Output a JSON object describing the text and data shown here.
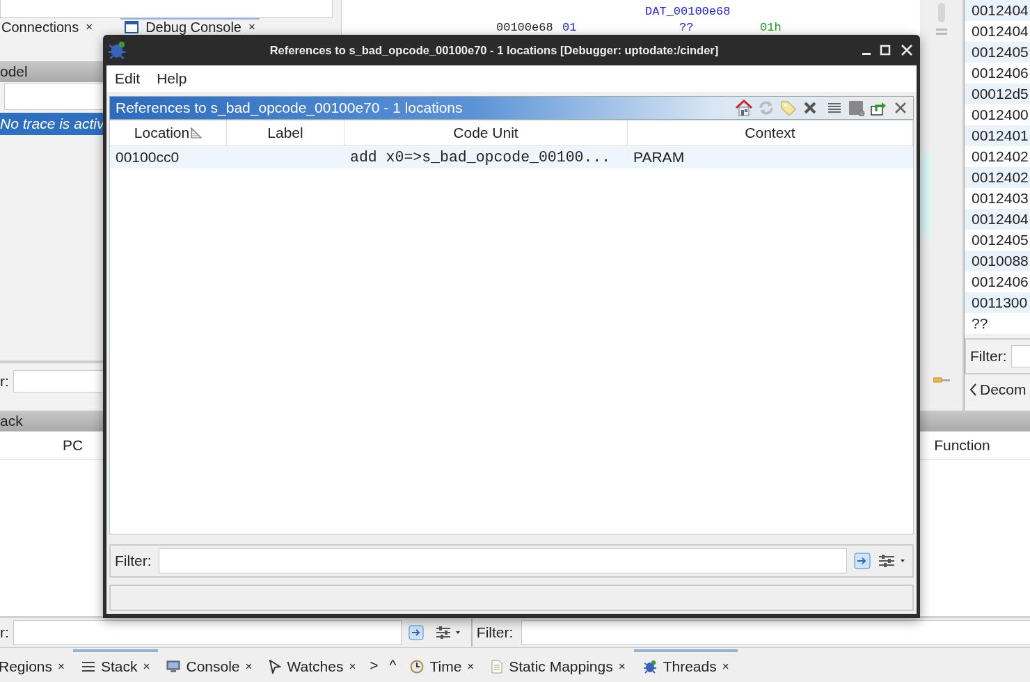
{
  "upper_left": {
    "tabs": [
      {
        "label": "Connections",
        "close": "×",
        "selected": false
      },
      {
        "label": "Debug Console",
        "close": "×",
        "selected": true
      }
    ],
    "model_header": "odel",
    "trace_message": "No trace is activ",
    "filter_label": "r:"
  },
  "listing": {
    "label": "DAT_00100e68",
    "address": "00100e68",
    "bytes": "01",
    "mnemonic": "??",
    "operand": "01h"
  },
  "right_list": {
    "rows": [
      "0012404",
      "0012404",
      "0012405",
      "0012406",
      "00012d5",
      "0012400",
      "0012401",
      "0012402",
      "0012402",
      "0012403",
      "0012404",
      "0012405",
      "0010088",
      "0012406",
      "0011300",
      "??"
    ],
    "filter_label": "Filter:",
    "nav_label": "Decom"
  },
  "stack_panel": {
    "title": "ack",
    "column": "PC"
  },
  "threads_panel": {
    "column": "Function"
  },
  "filter_bars": [
    {
      "label": "r:"
    },
    {
      "label": "Filter:"
    }
  ],
  "bottom_tabs_left": [
    {
      "label": "Regions",
      "close": "×",
      "selected": false
    },
    {
      "label": "Stack",
      "close": "×",
      "selected": true
    },
    {
      "label": "Console",
      "close": "×",
      "selected": false
    },
    {
      "label": "Watches",
      "close": "×",
      "selected": false
    }
  ],
  "tab_nav": [
    ">",
    "^"
  ],
  "bottom_tabs_right": [
    {
      "label": "Time",
      "close": "×",
      "selected": false
    },
    {
      "label": "Static Mappings",
      "close": "×",
      "selected": false
    },
    {
      "label": "Threads",
      "close": "×",
      "selected": true
    }
  ],
  "dialog": {
    "title": "References to s_bad_opcode_00100e70 - 1 locations [Debugger: uptodate:/cinder]",
    "menu": [
      "Edit",
      "Help"
    ],
    "panel_title": "References to s_bad_opcode_00100e70 - 1 locations",
    "columns": [
      {
        "label": "Location",
        "sorted": true
      },
      {
        "label": "Label",
        "sorted": false
      },
      {
        "label": "Code Unit",
        "sorted": false
      },
      {
        "label": "Context",
        "sorted": false
      }
    ],
    "rows": [
      {
        "location": "00100cc0",
        "code_unit": "add x0=>s_bad_opcode_00100...",
        "context": "PARAM"
      }
    ],
    "filter_label": "Filter:"
  }
}
